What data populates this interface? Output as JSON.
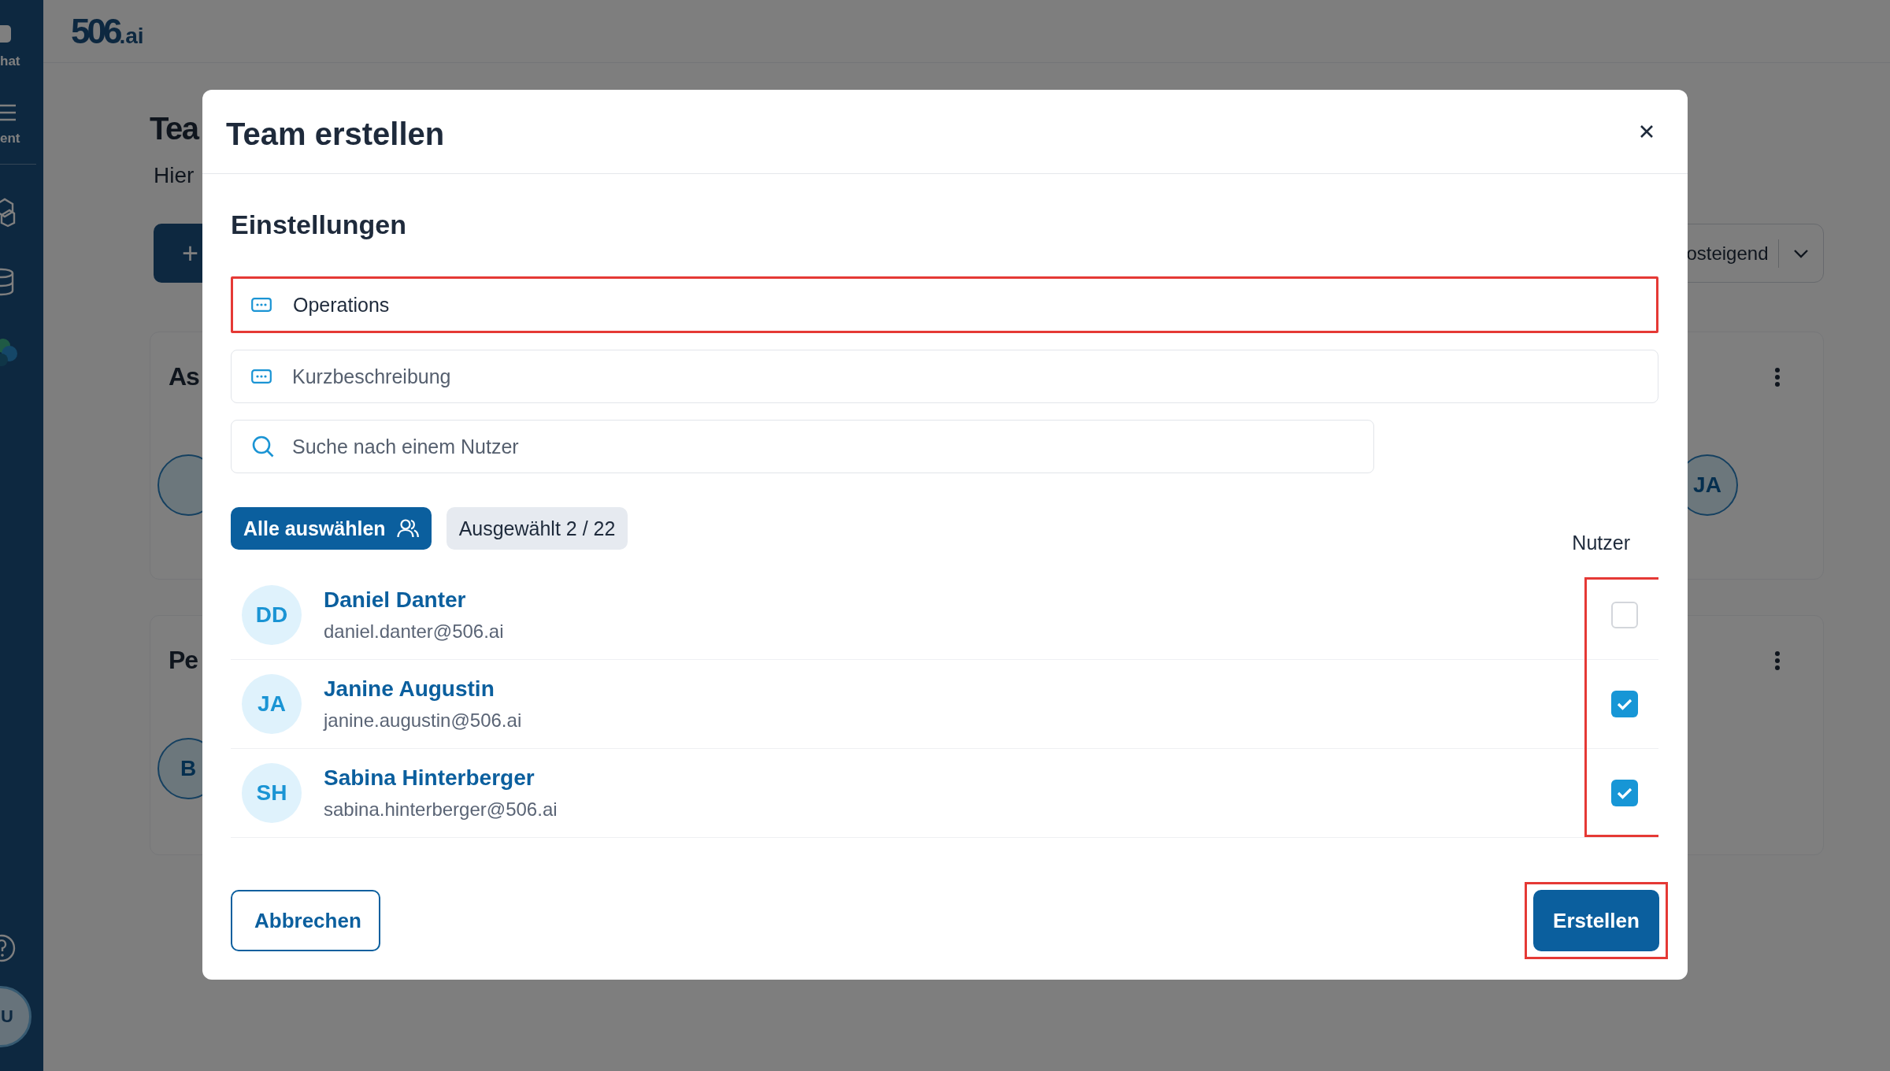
{
  "sidebar": {
    "items": [
      {
        "label": "hat"
      },
      {
        "label": "ent"
      }
    ],
    "avatar": "U"
  },
  "header": {
    "logo": {
      "mark": "506",
      "suffix": ".ai"
    }
  },
  "page": {
    "title": "Tea",
    "subtitle": "Hier",
    "add_button": "+",
    "sort_dropdown": "osteigend",
    "sections": [
      {
        "title": "As",
        "avatars": [
          {
            "kind": "left"
          },
          {
            "kind": "right",
            "initials": "JA"
          }
        ]
      },
      {
        "title": "Pe",
        "avatars": [
          {
            "kind": "left",
            "initials": "B"
          }
        ]
      }
    ]
  },
  "modal": {
    "title": "Team erstellen",
    "section_title": "Einstellungen",
    "fields": [
      {
        "kind": "text",
        "value": "Operations",
        "highlighted": true
      },
      {
        "kind": "text",
        "placeholder": "Kurzbeschreibung",
        "highlighted": false
      },
      {
        "kind": "search",
        "placeholder": "Suche nach einem Nutzer",
        "highlighted": false
      }
    ],
    "select_all_button": "Alle auswählen",
    "selected_count": "Ausgewählt 2 / 22",
    "column_label": "Nutzer",
    "checkbox_column_highlighted": true,
    "users": [
      {
        "initials": "DD",
        "name": "Daniel Danter",
        "email": "daniel.danter@506.ai",
        "checked": false
      },
      {
        "initials": "JA",
        "name": "Janine Augustin",
        "email": "janine.augustin@506.ai",
        "checked": true
      },
      {
        "initials": "SH",
        "name": "Sabina Hinterberger",
        "email": "sabina.hinterberger@506.ai",
        "checked": true
      }
    ],
    "buttons": [
      {
        "kind": "secondary",
        "label": "Abbrechen",
        "highlighted": false
      },
      {
        "kind": "primary",
        "label": "Erstellen",
        "highlighted": true
      }
    ]
  }
}
